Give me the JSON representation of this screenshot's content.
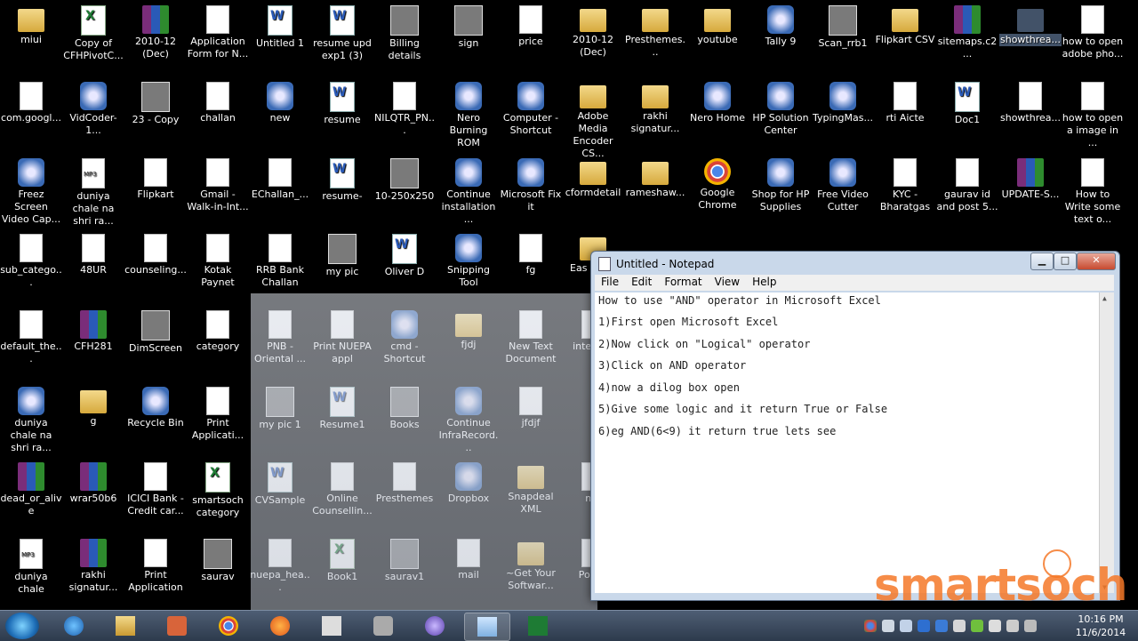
{
  "desktop": {
    "icons": [
      {
        "label": "miui",
        "type": "folder"
      },
      {
        "label": "Copy of CFHPivotC...",
        "type": "excel"
      },
      {
        "label": "2010-12 (Dec)",
        "type": "rar"
      },
      {
        "label": "Application Form for N...",
        "type": "doc"
      },
      {
        "label": "Untitled 1",
        "type": "word"
      },
      {
        "label": "resume upd exp1 (3)",
        "type": "word"
      },
      {
        "label": "Billing details",
        "type": "img"
      },
      {
        "label": "sign",
        "type": "img"
      },
      {
        "label": "price",
        "type": "doc"
      },
      {
        "label": "2010-12 (Dec)",
        "type": "folder"
      },
      {
        "label": "Presthemes...",
        "type": "folder"
      },
      {
        "label": "youtube",
        "type": "folder"
      },
      {
        "label": "Tally 9",
        "type": "prog"
      },
      {
        "label": "Scan_rrb1",
        "type": "img"
      },
      {
        "label": "Flipkart CSV",
        "type": "folder"
      },
      {
        "label": "sitemaps.c2...",
        "type": "rar"
      },
      {
        "label": "showthrea...",
        "type": "folder"
      },
      {
        "label": "how to open adobe pho...",
        "type": "doc"
      },
      {
        "label": "com.googl...",
        "type": "doc"
      },
      {
        "label": "VidCoder-1...",
        "type": "prog"
      },
      {
        "label": "23 - Copy",
        "type": "img"
      },
      {
        "label": "challan",
        "type": "doc"
      },
      {
        "label": "new",
        "type": "prog"
      },
      {
        "label": "resume",
        "type": "word"
      },
      {
        "label": "NILQTR_PN...",
        "type": "doc"
      },
      {
        "label": "Nero Burning ROM",
        "type": "prog"
      },
      {
        "label": "Computer - Shortcut",
        "type": "prog"
      },
      {
        "label": "Adobe Media Encoder CS...",
        "type": "folder"
      },
      {
        "label": "rakhi signatur...",
        "type": "folder"
      },
      {
        "label": "Nero Home",
        "type": "prog"
      },
      {
        "label": "HP Solution Center",
        "type": "prog"
      },
      {
        "label": "TypingMas...",
        "type": "prog"
      },
      {
        "label": "rti Aicte",
        "type": "doc"
      },
      {
        "label": "Doc1",
        "type": "word"
      },
      {
        "label": "showthrea...",
        "type": "doc"
      },
      {
        "label": "how to open a image in ...",
        "type": "doc"
      },
      {
        "label": "Freez Screen Video Cap...",
        "type": "prog"
      },
      {
        "label": "duniya chale na shri ra...",
        "type": "mp3"
      },
      {
        "label": "Flipkart",
        "type": "doc"
      },
      {
        "label": "Gmail - Walk-in-Int...",
        "type": "doc"
      },
      {
        "label": "EChallan_...",
        "type": "doc"
      },
      {
        "label": "resume-",
        "type": "word"
      },
      {
        "label": "10-250x250",
        "type": "img"
      },
      {
        "label": "Continue installation ...",
        "type": "prog"
      },
      {
        "label": "Microsoft Fix it",
        "type": "prog"
      },
      {
        "label": "cformdetail",
        "type": "folder"
      },
      {
        "label": "rameshaw...",
        "type": "folder"
      },
      {
        "label": "Google Chrome",
        "type": "chrome"
      },
      {
        "label": "Shop for HP Supplies",
        "type": "prog"
      },
      {
        "label": "Free Video Cutter",
        "type": "prog"
      },
      {
        "label": "KYC - Bharatgas",
        "type": "doc"
      },
      {
        "label": "gaurav id and post 5...",
        "type": "doc"
      },
      {
        "label": "UPDATE-S...",
        "type": "rar"
      },
      {
        "label": "How to Write some text o...",
        "type": "doc"
      },
      {
        "label": "sub_catego...",
        "type": "doc"
      },
      {
        "label": "48UR",
        "type": "doc"
      },
      {
        "label": "counseling...",
        "type": "doc"
      },
      {
        "label": "Kotak Paynet",
        "type": "doc"
      },
      {
        "label": "RRB Bank Challan",
        "type": "doc"
      },
      {
        "label": "my pic",
        "type": "img"
      },
      {
        "label": "Oliver D",
        "type": "word"
      },
      {
        "label": "Snipping Tool",
        "type": "prog"
      },
      {
        "label": "fg",
        "type": "doc"
      },
      {
        "label": "Eas Extra",
        "type": "folder"
      },
      {
        "label": "default_the...",
        "type": "doc"
      },
      {
        "label": "CFH281",
        "type": "rar"
      },
      {
        "label": "DimScreen",
        "type": "img"
      },
      {
        "label": "category",
        "type": "doc"
      },
      {
        "label": "PNB -Oriental ...",
        "type": "doc"
      },
      {
        "label": "Print NUEPA appl",
        "type": "doc"
      },
      {
        "label": "cmd - Shortcut",
        "type": "prog"
      },
      {
        "label": "fjdj",
        "type": "folder"
      },
      {
        "label": "New Text Document",
        "type": "doc"
      },
      {
        "label": "inte wys",
        "type": "doc"
      },
      {
        "label": "duniya chale na shri ra...",
        "type": "prog"
      },
      {
        "label": "g",
        "type": "folder"
      },
      {
        "label": "Recycle Bin",
        "type": "prog"
      },
      {
        "label": "Print Applicati...",
        "type": "doc"
      },
      {
        "label": "my pic 1",
        "type": "img"
      },
      {
        "label": "Resume1",
        "type": "word"
      },
      {
        "label": "Books",
        "type": "img"
      },
      {
        "label": "Continue InfraRecord...",
        "type": "prog"
      },
      {
        "label": "jfdjf",
        "type": "doc"
      },
      {
        "label": "dead_or_alive",
        "type": "rar"
      },
      {
        "label": "wrar50b6",
        "type": "rar"
      },
      {
        "label": "ICICI Bank - Credit car...",
        "type": "doc"
      },
      {
        "label": "smartsoch category",
        "type": "excel"
      },
      {
        "label": "CVSample",
        "type": "word"
      },
      {
        "label": "Online Counsellin...",
        "type": "doc"
      },
      {
        "label": "Presthemes",
        "type": "doc"
      },
      {
        "label": "Dropbox",
        "type": "prog"
      },
      {
        "label": "Snapdeal XML",
        "type": "folder"
      },
      {
        "label": "ma",
        "type": "doc"
      },
      {
        "label": "duniya chale",
        "type": "mp3"
      },
      {
        "label": "rakhi signatur...",
        "type": "rar"
      },
      {
        "label": "Print Application",
        "type": "doc"
      },
      {
        "label": "saurav",
        "type": "img"
      },
      {
        "label": "nuepa_hea...",
        "type": "doc"
      },
      {
        "label": "Book1",
        "type": "excel"
      },
      {
        "label": "saurav1",
        "type": "img"
      },
      {
        "label": "mail",
        "type": "doc"
      },
      {
        "label": "~Get Your Softwar...",
        "type": "folder"
      },
      {
        "label": "Po Vis",
        "type": "doc"
      }
    ]
  },
  "notepad": {
    "title": "Untitled - Notepad",
    "controls": {
      "minimize": "▁",
      "maximize": "□",
      "close": "✕"
    },
    "menu": [
      "File",
      "Edit",
      "Format",
      "View",
      "Help"
    ],
    "lines": [
      "How to use \"AND\" operator in Microsoft Excel",
      "1)First open Microsoft Excel",
      "2)Now click on \"Logical\" operator",
      "3)Click on AND operator",
      "4)now a dilog box open",
      "5)Give some logic and it return True or False",
      "6)eg AND(6<9) it return true lets see"
    ]
  },
  "watermark": {
    "text": "smartsoch"
  },
  "taskbar": {
    "clock": {
      "time": "10:16 PM",
      "date": "11/6/2014"
    }
  }
}
